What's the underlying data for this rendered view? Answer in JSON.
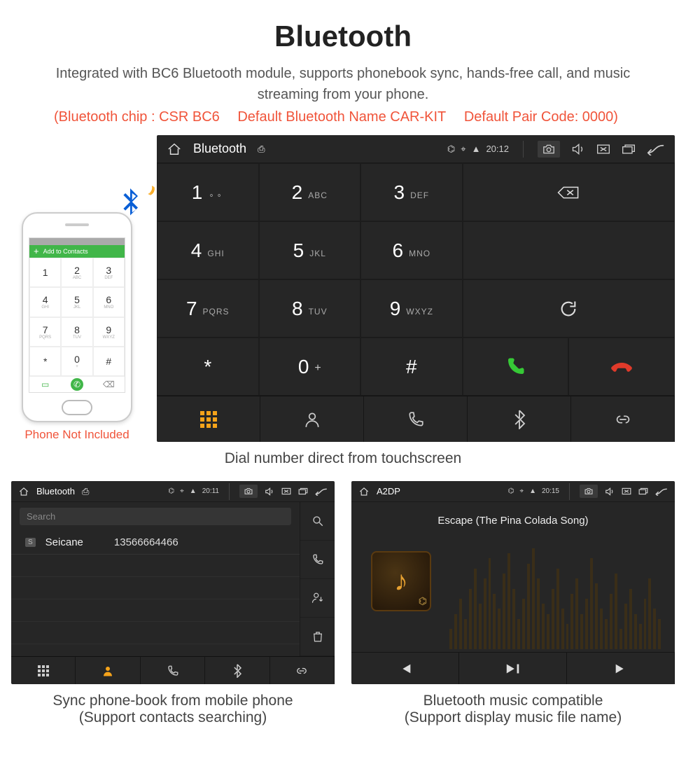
{
  "header": {
    "title": "Bluetooth",
    "subtitle": "Integrated with BC6 Bluetooth module, supports phonebook sync, hands-free call, and music streaming from your phone.",
    "spec_chip": "(Bluetooth chip : CSR BC6",
    "spec_name": "Default Bluetooth Name CAR-KIT",
    "spec_code": "Default Pair Code: 0000)"
  },
  "phone_mock": {
    "add_contacts": "Add to Contacts",
    "note": "Phone Not Included",
    "keys": [
      {
        "d": "1",
        "l": ""
      },
      {
        "d": "2",
        "l": "ABC"
      },
      {
        "d": "3",
        "l": "DEF"
      },
      {
        "d": "4",
        "l": "GHI"
      },
      {
        "d": "5",
        "l": "JKL"
      },
      {
        "d": "6",
        "l": "MNO"
      },
      {
        "d": "7",
        "l": "PQRS"
      },
      {
        "d": "8",
        "l": "TUV"
      },
      {
        "d": "9",
        "l": "WXYZ"
      },
      {
        "d": "*",
        "l": ""
      },
      {
        "d": "0",
        "l": "+"
      },
      {
        "d": "#",
        "l": ""
      }
    ]
  },
  "dialer": {
    "caption": "Dial number direct from touchscreen",
    "hu_title": "Bluetooth",
    "time": "20:12",
    "keys": [
      {
        "d": "1",
        "t": "",
        "vm": true
      },
      {
        "d": "2",
        "t": "ABC"
      },
      {
        "d": "3",
        "t": "DEF"
      },
      {
        "d": "4",
        "t": "GHI"
      },
      {
        "d": "5",
        "t": "JKL"
      },
      {
        "d": "6",
        "t": "MNO"
      },
      {
        "d": "7",
        "t": "PQRS"
      },
      {
        "d": "8",
        "t": "TUV"
      },
      {
        "d": "9",
        "t": "WXYZ"
      },
      {
        "d": "*",
        "t": ""
      },
      {
        "d": "0",
        "t": "",
        "plus": true
      },
      {
        "d": "#",
        "t": ""
      }
    ]
  },
  "contacts": {
    "hu_title": "Bluetooth",
    "time": "20:11",
    "search_placeholder": "Search",
    "badge": "S",
    "name": "Seicane",
    "number": "13566664466",
    "caption_line1": "Sync phone-book from mobile phone",
    "caption_line2": "(Support contacts searching)"
  },
  "music": {
    "hu_title": "A2DP",
    "time": "20:15",
    "track": "Escape (The Pina Colada Song)",
    "caption_line1": "Bluetooth music compatible",
    "caption_line2": "(Support display music file name)"
  }
}
